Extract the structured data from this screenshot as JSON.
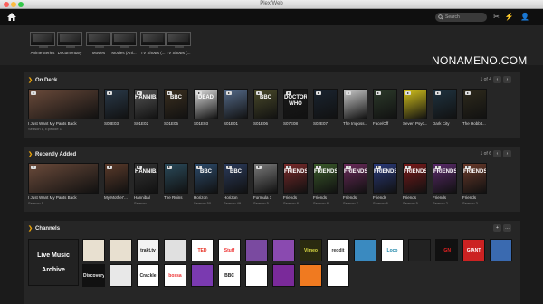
{
  "window": {
    "title": "Plex/Web"
  },
  "search": {
    "placeholder": "Search"
  },
  "libraries": [
    {
      "label": "Anime Series"
    },
    {
      "label": "Documentary"
    },
    {
      "label": "Movies"
    },
    {
      "label": "Movies (Ani..."
    },
    {
      "label": "TV Shows (..."
    },
    {
      "label": "TV Shows (..."
    }
  ],
  "watermark": "NONAMENO.COM",
  "on_deck": {
    "title": "On Deck",
    "page": "1 of 4",
    "items": [
      {
        "title": "I Just Want My Pants Back",
        "sub": "Season 1, Episode 1",
        "color": "#6a4a3a",
        "mark": ""
      },
      {
        "title": "S08E03",
        "sub": "",
        "color": "#2a3a4a",
        "mark": ""
      },
      {
        "title": "S01E02",
        "sub": "",
        "color": "#555",
        "mark": "HANNIBAL"
      },
      {
        "title": "S01E05",
        "sub": "",
        "color": "#3b2f1f",
        "mark": "BBC"
      },
      {
        "title": "S01E03",
        "sub": "",
        "color": "#ddd",
        "mark": "DEAD"
      },
      {
        "title": "S01E01",
        "sub": "",
        "color": "#556b8a",
        "mark": ""
      },
      {
        "title": "S01E06",
        "sub": "",
        "color": "#4a4a2a",
        "mark": "BBC"
      },
      {
        "title": "S07E08",
        "sub": "",
        "color": "#1a1a1a",
        "mark": "DOCTOR WHO"
      },
      {
        "title": "S02E07",
        "sub": "",
        "color": "#1a2430",
        "mark": ""
      },
      {
        "title": "The Imposs...",
        "sub": "",
        "color": "#c9c9c9",
        "mark": ""
      },
      {
        "title": "Face/Off",
        "sub": "",
        "color": "#2c3a2a",
        "mark": ""
      },
      {
        "title": "Seven Psyc...",
        "sub": "",
        "color": "#d4c21c",
        "mark": ""
      },
      {
        "title": "Dark City",
        "sub": "",
        "color": "#1f3340",
        "mark": ""
      },
      {
        "title": "The Hobbit...",
        "sub": "",
        "color": "#2e2a1c",
        "mark": ""
      }
    ]
  },
  "recently_added": {
    "title": "Recently Added",
    "page": "1 of 6",
    "items": [
      {
        "title": "I Just Want My Pants Back",
        "sub": "Season 1",
        "color": "#6a4a3a",
        "mark": ""
      },
      {
        "title": "My Mother'...",
        "sub": "",
        "color": "#5a3a2a",
        "mark": ""
      },
      {
        "title": "Hannibal",
        "sub": "Season 1",
        "color": "#333",
        "mark": "HANNIBAL"
      },
      {
        "title": "The Ruins",
        "sub": "",
        "color": "#2a4a5a",
        "mark": ""
      },
      {
        "title": "Horizon",
        "sub": "Season 50",
        "color": "#2c4a6a",
        "mark": "BBC"
      },
      {
        "title": "Horizon",
        "sub": "Season 49",
        "color": "#2a3a5a",
        "mark": "BBC"
      },
      {
        "title": "Formula 1",
        "sub": "Season 5",
        "color": "#7a7a7a",
        "mark": ""
      },
      {
        "title": "Friends",
        "sub": "Season 8",
        "color": "#7a2a2a",
        "mark": "FRIENDS"
      },
      {
        "title": "Friends",
        "sub": "Season 8",
        "color": "#3a5a2a",
        "mark": "FRIENDS"
      },
      {
        "title": "Friends",
        "sub": "Season 7",
        "color": "#6a2a5a",
        "mark": "FRIENDS"
      },
      {
        "title": "Friends",
        "sub": "Season 6",
        "color": "#2a3a7a",
        "mark": "FRIENDS"
      },
      {
        "title": "Friends",
        "sub": "Season 5",
        "color": "#7a1a1a",
        "mark": "FRIENDS"
      },
      {
        "title": "Friends",
        "sub": "Season 2",
        "color": "#5a2a6a",
        "mark": "FRIENDS"
      },
      {
        "title": "Friends",
        "sub": "Season 3",
        "color": "#6a3a2a",
        "mark": "FRIENDS"
      }
    ]
  },
  "channels": {
    "title": "Channels",
    "items": [
      {
        "label": "Live Music Archive",
        "bg": "#222",
        "fg": "#fff"
      },
      {
        "label": "",
        "bg": "#e8e0d0",
        "fg": "#333"
      },
      {
        "label": "",
        "bg": "#e8e0d0",
        "fg": "#333"
      },
      {
        "label": "trakt.tv",
        "bg": "#f2f2f2",
        "fg": "#222"
      },
      {
        "label": "",
        "bg": "#e0e0e0",
        "fg": "#333"
      },
      {
        "label": "TED",
        "bg": "#fff",
        "fg": "#e62b1e"
      },
      {
        "label": "Stuff",
        "bg": "#fff",
        "fg": "#e33"
      },
      {
        "label": "",
        "bg": "#7a4aa0",
        "fg": "#fff"
      },
      {
        "label": "",
        "bg": "#8a4ab0",
        "fg": "#fff"
      },
      {
        "label": "Vimeo",
        "bg": "#2a2a10",
        "fg": "#dd4"
      },
      {
        "label": "reddit",
        "bg": "#fff",
        "fg": "#333"
      },
      {
        "label": "",
        "bg": "#3a8ac0",
        "fg": "#fff"
      },
      {
        "label": "Loco",
        "bg": "#fff",
        "fg": "#28a"
      },
      {
        "label": "",
        "bg": "#222",
        "fg": "#e6a10c"
      },
      {
        "label": "IGN",
        "bg": "#111",
        "fg": "#e22"
      },
      {
        "label": "GIANT BOMB",
        "bg": "#c22",
        "fg": "#fff"
      },
      {
        "label": "",
        "bg": "#3a6ab0",
        "fg": "#fff"
      },
      {
        "label": "Discovery",
        "bg": "#111",
        "fg": "#eee"
      },
      {
        "label": "",
        "bg": "#e8e8e8",
        "fg": "#333"
      },
      {
        "label": "Crackle",
        "bg": "#fff",
        "fg": "#222"
      },
      {
        "label": "bossa",
        "bg": "#fff",
        "fg": "#e33"
      },
      {
        "label": "",
        "bg": "#7a3ab0",
        "fg": "#fff"
      },
      {
        "label": "BBC",
        "bg": "#fff",
        "fg": "#222"
      },
      {
        "label": "",
        "bg": "#fff",
        "fg": "#333"
      },
      {
        "label": "",
        "bg": "#7a2a9a",
        "fg": "#fff"
      },
      {
        "label": "",
        "bg": "#f07a20",
        "fg": "#fff"
      },
      {
        "label": "",
        "bg": "#fff",
        "fg": "#e6a10c"
      }
    ]
  }
}
